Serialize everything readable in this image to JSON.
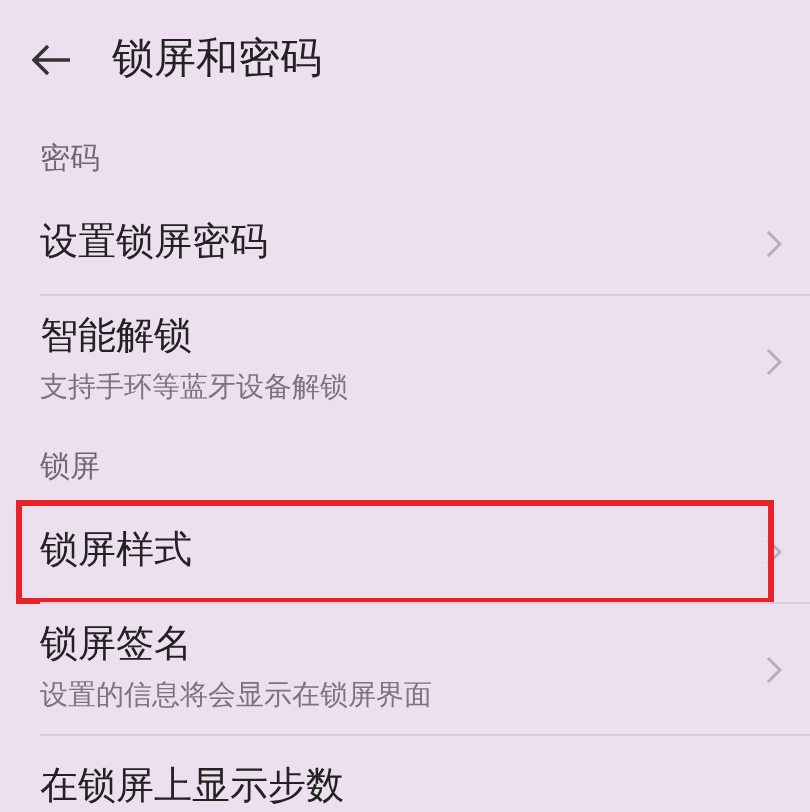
{
  "header": {
    "title": "锁屏和密码"
  },
  "sections": [
    {
      "title": "密码",
      "items": [
        {
          "label": "设置锁屏密码",
          "chevron": true,
          "highlighted": false
        },
        {
          "label": "智能解锁",
          "subtitle": "支持手环等蓝牙设备解锁",
          "chevron": true,
          "highlighted": false
        }
      ]
    },
    {
      "title": "锁屏",
      "items": [
        {
          "label": "锁屏样式",
          "chevron": true,
          "highlighted": true
        },
        {
          "label": "锁屏签名",
          "subtitle": "设置的信息将会显示在锁屏界面",
          "chevron": true,
          "highlighted": false
        },
        {
          "label": "在锁屏上显示步数",
          "chevron": false,
          "highlighted": false
        }
      ]
    }
  ]
}
